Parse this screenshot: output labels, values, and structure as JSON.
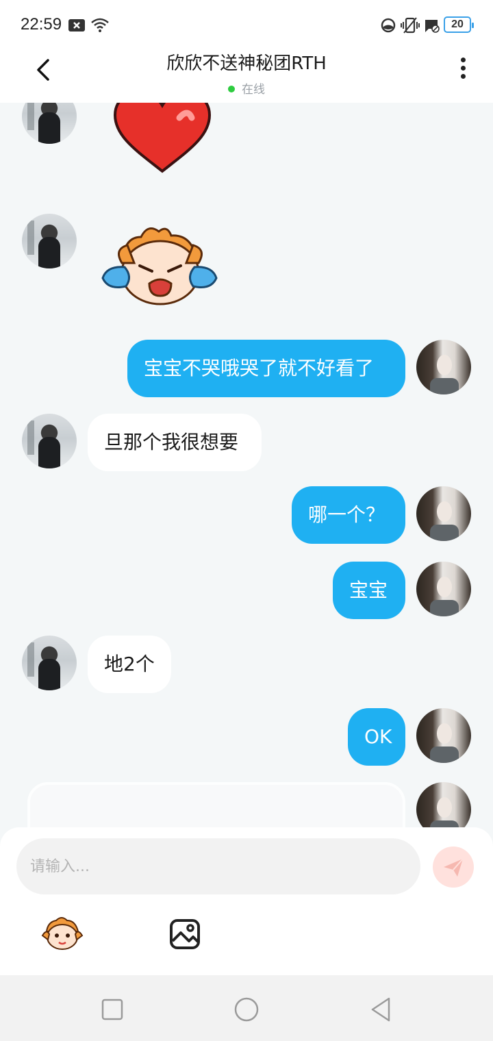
{
  "status_bar": {
    "time": "22:59",
    "battery": "20",
    "icons": [
      "close-box-icon",
      "wifi-icon",
      "moon-icon",
      "vibrate-icon",
      "message-blocked-icon",
      "battery-icon"
    ]
  },
  "header": {
    "title": "欣欣不送神秘团RTH",
    "online_label": "在线",
    "online_color": "#2ecc40"
  },
  "messages": [
    {
      "side": "in",
      "type": "sticker",
      "sticker": "heart-sticker"
    },
    {
      "side": "in",
      "type": "sticker",
      "sticker": "crying-character-sticker"
    },
    {
      "side": "out",
      "type": "text",
      "text": "宝宝不哭哦哭了就不好看了"
    },
    {
      "side": "in",
      "type": "text",
      "text": "旦那个我很想要"
    },
    {
      "side": "out",
      "type": "text",
      "text": "哪一个？"
    },
    {
      "side": "out",
      "type": "text",
      "text": "宝宝"
    },
    {
      "side": "in",
      "type": "text",
      "text": "地2个"
    },
    {
      "side": "out",
      "type": "text",
      "text": "OK"
    },
    {
      "side": "out",
      "type": "card",
      "text": ""
    }
  ],
  "input": {
    "placeholder": "请输入..."
  },
  "colors": {
    "accent": "#1fb0f2",
    "send_button": "#ffe1dd",
    "background": "#f4f7f8"
  },
  "toolbar": {
    "icons": [
      "emoji-sticker-icon",
      "image-icon"
    ]
  },
  "nav": {
    "icons": [
      "recent-apps-icon",
      "home-icon",
      "back-icon"
    ]
  }
}
